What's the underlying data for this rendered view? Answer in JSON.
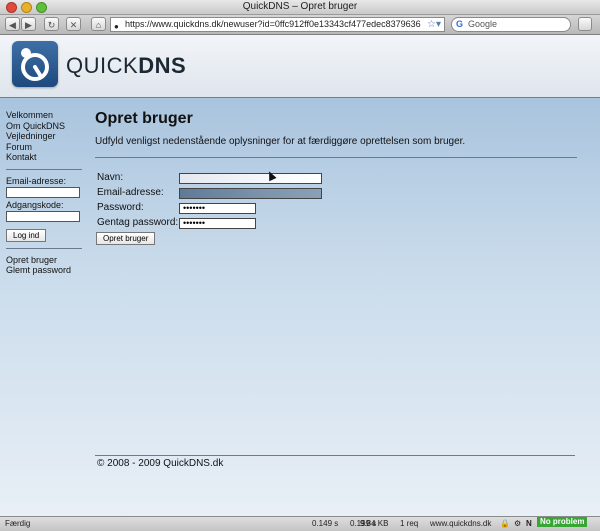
{
  "window": {
    "title": "QuickDNS – Opret bruger"
  },
  "toolbar": {
    "url": "https://www.quickdns.dk/newuser?id=0ffc912ff0e13343cf477edec8379636",
    "search_placeholder": "Google"
  },
  "brand": {
    "name_light": "QUICK",
    "name_bold": "DNS"
  },
  "sidebar": {
    "links": [
      "Velkommen",
      "Om QuickDNS",
      "Vejledninger",
      "Forum",
      "Kontakt"
    ],
    "email_label": "Email-adresse:",
    "password_label": "Adgangskode:",
    "login_button": "Log ind",
    "bottom_links": [
      "Opret bruger",
      "Glemt password"
    ]
  },
  "main": {
    "title": "Opret bruger",
    "intro": "Udfyld venligst nedenstående oplysninger for at færdiggøre oprettelsen som bruger.",
    "form": {
      "name_label": "Navn:",
      "email_label": "Email-adresse:",
      "password_label": "Password:",
      "password_value": "•••••••",
      "repeat_label": "Gentag password:",
      "repeat_value": "•••••••",
      "submit": "Opret bruger"
    },
    "footer": "© 2008 - 2009 QuickDNS.dk"
  },
  "statusbar": {
    "status": "Færdig",
    "time1": "0.149 s",
    "time2": "0.199 s",
    "size": "9.84 KB",
    "requests": "1 req",
    "domain": "www.quickdns.dk",
    "badge": "No problem"
  },
  "colors": {
    "accent": "#1e4a7d",
    "badge": "#37a635"
  }
}
